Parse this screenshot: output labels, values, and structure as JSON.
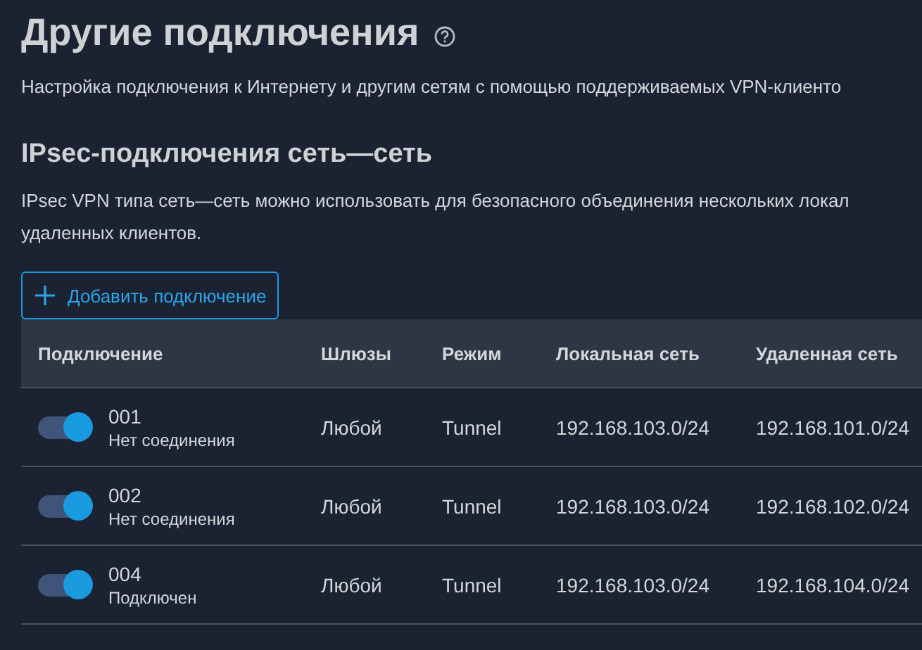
{
  "page": {
    "title": "Другие подключения",
    "description": "Настройка подключения к Интернету и другим сетям с помощью поддерживаемых VPN-клиенто"
  },
  "section": {
    "title": "IPsec-подключения сеть—сеть",
    "description": "IPsec VPN типа сеть—сеть можно использовать для безопасного объединения нескольких локал удаленных клиентов.",
    "add_button": "Добавить подключение"
  },
  "table": {
    "columns": [
      "Подключение",
      "Шлюзы",
      "Режим",
      "Локальная сеть",
      "Удаленная сеть"
    ],
    "rows": [
      {
        "on": true,
        "name": "001",
        "status": "Нет соединения",
        "gateways": "Любой",
        "mode": "Tunnel",
        "local": "192.168.103.0/24",
        "remote": "192.168.101.0/24"
      },
      {
        "on": true,
        "name": "002",
        "status": "Нет соединения",
        "gateways": "Любой",
        "mode": "Tunnel",
        "local": "192.168.103.0/24",
        "remote": "192.168.102.0/24"
      },
      {
        "on": true,
        "name": "004",
        "status": "Подключен",
        "gateways": "Любой",
        "mode": "Tunnel",
        "local": "192.168.103.0/24",
        "remote": "192.168.104.0/24"
      }
    ]
  }
}
